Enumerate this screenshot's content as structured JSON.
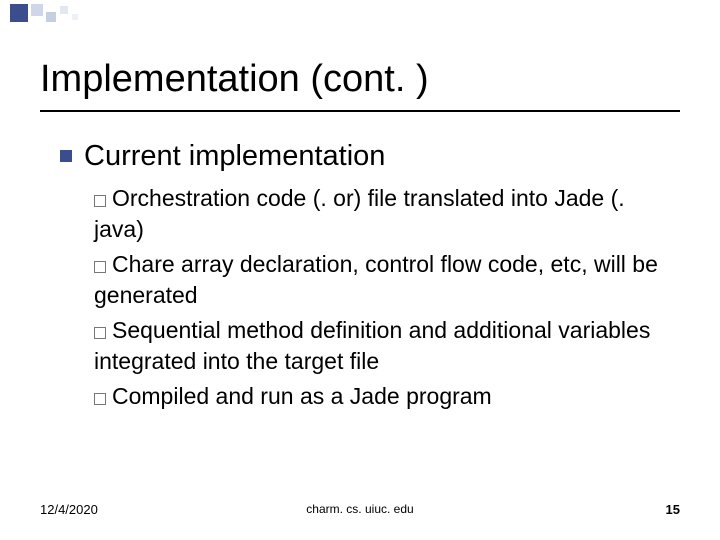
{
  "title": "Implementation (cont. )",
  "heading": {
    "label": "Current implementation"
  },
  "sub": [
    {
      "lead": "Orchestration",
      "rest": " code (. or) file translated into Jade (. java)"
    },
    {
      "lead": "Chare",
      "rest": " array declaration, control flow code, etc, will be generated"
    },
    {
      "lead": "Sequential",
      "rest": " method definition and additional variables integrated into the target file"
    },
    {
      "lead": "Compiled",
      "rest": " and run as a Jade program"
    }
  ],
  "footer": {
    "date": "12/4/2020",
    "url": "charm. cs. uiuc. edu",
    "page": "15"
  }
}
